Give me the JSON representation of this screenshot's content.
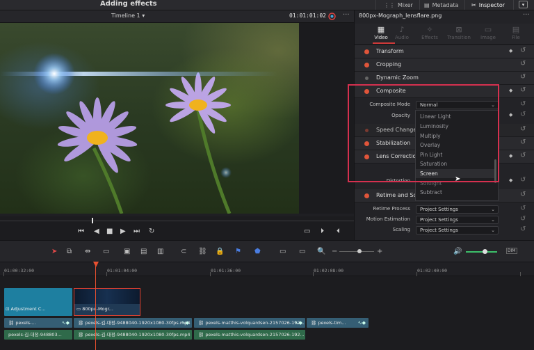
{
  "topbar": {
    "title": "Adding effects",
    "mixer": "Mixer",
    "metadata": "Metadata",
    "inspector": "Inspector"
  },
  "viewer": {
    "timeline_name": "Timeline 1",
    "timecode": "01:01:01:02"
  },
  "inspector": {
    "clip_name": "800px-Mograph_lensflare.png",
    "tabs": [
      {
        "label": "Video",
        "icon": "film-icon"
      },
      {
        "label": "Audio",
        "icon": "music-note-icon"
      },
      {
        "label": "Effects",
        "icon": "wand-icon"
      },
      {
        "label": "Transition",
        "icon": "transition-icon"
      },
      {
        "label": "Image",
        "icon": "image-icon"
      },
      {
        "label": "File",
        "icon": "file-icon"
      }
    ],
    "sections": [
      {
        "label": "Transform",
        "enabled": true
      },
      {
        "label": "Cropping",
        "enabled": true
      },
      {
        "label": "Dynamic Zoom",
        "enabled": false
      },
      {
        "label": "Composite",
        "enabled": true
      },
      {
        "label": "Speed Change",
        "enabled": false
      },
      {
        "label": "Stabilization",
        "enabled": true
      },
      {
        "label": "Lens Correction",
        "enabled": true
      },
      {
        "label": "Retime and Scaling",
        "enabled": true
      }
    ],
    "composite_mode_label": "Composite Mode",
    "composite_mode_value": "Normal",
    "opacity_label": "Opacity",
    "distortion_label": "Distortion",
    "retime_process_label": "Retime Process",
    "retime_process_value": "Project Settings",
    "motion_estimation_label": "Motion Estimation",
    "motion_estimation_value": "Project Settings",
    "scaling_label": "Scaling",
    "scaling_value": "Project Settings",
    "dropdown_items": [
      "Linear Light",
      "Luminosity",
      "Multiply",
      "Overlay",
      "Pin Light",
      "Saturation",
      "Screen",
      "Softlight",
      "Subtract"
    ],
    "dropdown_selected": "Screen"
  },
  "timeline": {
    "timecodes": [
      "01:00:32:00",
      "01:01:04:00",
      "01:01:36:00",
      "01:02:08:00",
      "01:02:40:00"
    ],
    "clips": {
      "adjustment": "Adjustment C...",
      "lensflare": "800px-Mogr...",
      "v1_a": "pexels-...",
      "v1_b": "pexels-김-대정-9488040-1920x1080-30fps.mp4",
      "v1_c": "pexels-matthis-volquardsen-2157026-192...",
      "v1_d": "pexels-tim...",
      "a1_a": "pexels-김-대정-948803...",
      "a1_b": "pexels-김-대정-9488040-1920x1080-30fps.mp4",
      "a1_c": "pexels-matthis-volquardsen-2157026-192..."
    }
  },
  "colors": {
    "accent_red": "#e0553a",
    "highlight_box": "#d6304f",
    "video_clip": "#355e74",
    "audio_clip": "#2f6a4a"
  }
}
